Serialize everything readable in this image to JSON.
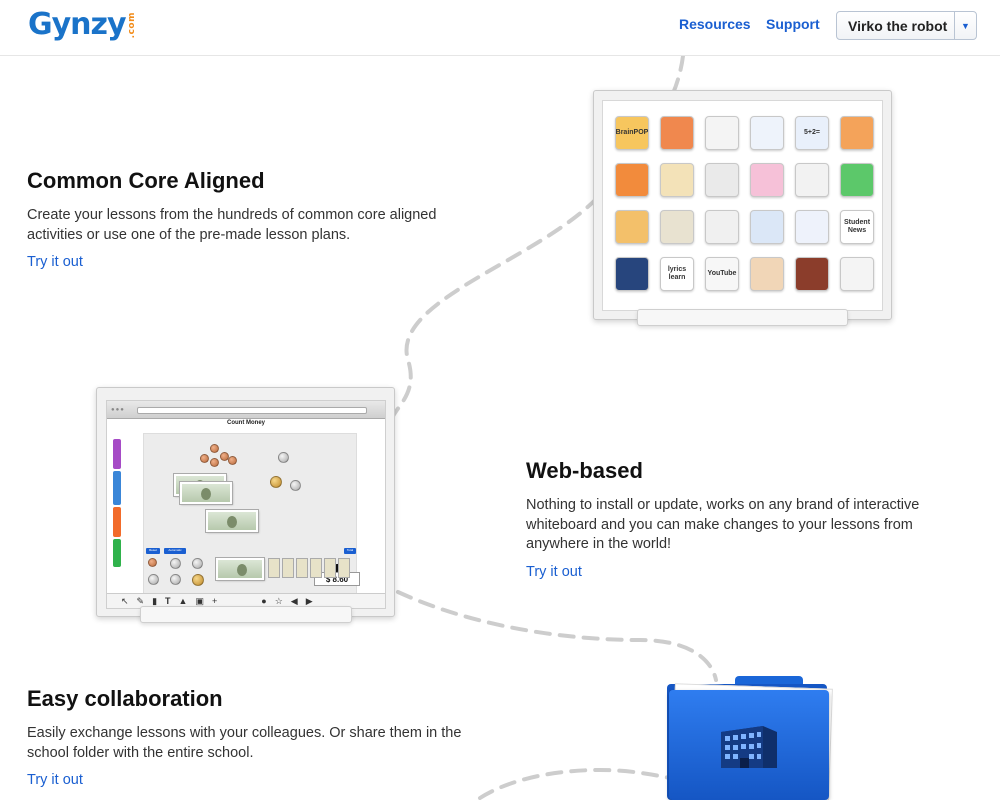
{
  "header": {
    "logo": "Gynzy",
    "logo_suffix": ".com",
    "nav": [
      {
        "label": "Resources"
      },
      {
        "label": "Support"
      }
    ],
    "user_menu": {
      "name": "Virko the robot",
      "caret_icon": "caret-down-icon"
    }
  },
  "sections": [
    {
      "title": "Common Core Aligned",
      "text": "Create your lessons from the hundreds of common core aligned activities or use one of the pre-made lesson plans.",
      "link": "Try it out"
    },
    {
      "title": "Web-based",
      "text": "Nothing to install or update, works on any brand of interactive whiteboard and you can make changes to your lessons from anywhere in the world!",
      "link": "Try it out"
    },
    {
      "title": "Easy collaboration",
      "text": "Easily exchange lessons with your colleagues. Or share them in the school folder with the entire school.",
      "link": "Try it out"
    }
  ],
  "app_tiles": [
    {
      "label": "BrainPOP",
      "color": "#f7c65e"
    },
    {
      "label": "",
      "color": "#f0884e"
    },
    {
      "label": "",
      "color": "#f4f4f4"
    },
    {
      "label": "",
      "color": "#eef3fb"
    },
    {
      "label": "5+2=",
      "color": "#e9f0fb"
    },
    {
      "label": "",
      "color": "#f4a35a"
    },
    {
      "label": "",
      "color": "#f28b3c"
    },
    {
      "label": "",
      "color": "#f3e2b8"
    },
    {
      "label": "",
      "color": "#eaeaea"
    },
    {
      "label": "",
      "color": "#f6c1d8"
    },
    {
      "label": "",
      "color": "#f2f2f2"
    },
    {
      "label": "",
      "color": "#5cc86a"
    },
    {
      "label": "",
      "color": "#f3c06a"
    },
    {
      "label": "",
      "color": "#e8e2d0"
    },
    {
      "label": "",
      "color": "#f0f0f0"
    },
    {
      "label": "",
      "color": "#dbe7f7"
    },
    {
      "label": "",
      "color": "#eef2fb"
    },
    {
      "label": "Student News",
      "color": "#ffffff"
    },
    {
      "label": "",
      "color": "#27457d"
    },
    {
      "label": "lyrics learn",
      "color": "#ffffff"
    },
    {
      "label": "YouTube",
      "color": "#f7f7f7"
    },
    {
      "label": "",
      "color": "#f1d6b7"
    },
    {
      "label": "",
      "color": "#8b3d2b"
    },
    {
      "label": "",
      "color": "#f4f4f4"
    }
  ],
  "money_screen": {
    "title": "Count Money",
    "total": "$ 8.60",
    "buttons": [
      "Reset",
      "Automatic",
      "Total"
    ]
  },
  "colors": {
    "link": "#1a5fd1",
    "logo_blue": "#1a73c9",
    "logo_red": "#e8312f",
    "logo_orange": "#f28c1a",
    "folder_blue": "#1a66d8",
    "path_gray": "#cccccc"
  }
}
